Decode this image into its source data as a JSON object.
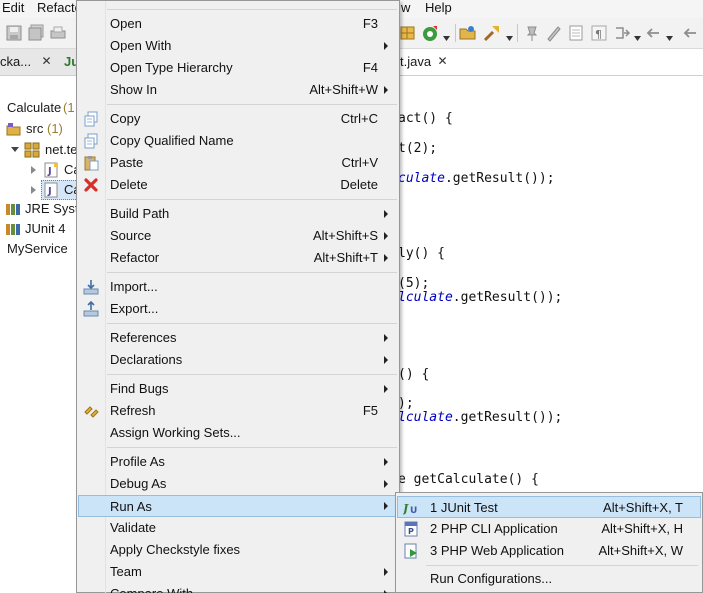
{
  "menubar": {
    "items": [
      "Edit",
      "Refacto",
      "w",
      "Help"
    ]
  },
  "left_tabs": {
    "package_tab": "cka...",
    "junit_tab": "Ju"
  },
  "editor_tabs": {
    "file_tab": "t.java"
  },
  "tree": {
    "project": "Calculate",
    "project_count": "(1",
    "src": "src",
    "src_count": "(1)",
    "package": "net.te",
    "file1": "Ca",
    "file2": "Ca",
    "jre": "JRE Syste",
    "junit": "JUnit 4",
    "service": "MyService"
  },
  "code": {
    "lines": [
      {
        "sig": "act() {",
        "field": ""
      },
      {
        "sig": "t(2);",
        "field": ""
      },
      {
        "sig": ".getResult());",
        "field": "culate"
      },
      {
        "sig": "ly() {",
        "field": ""
      },
      {
        "sig": "(5);",
        "field": ""
      },
      {
        "sig": ".getResult());",
        "field": "lculate"
      },
      {
        "sig": "() {",
        "field": ""
      },
      {
        "sig": ");",
        "field": ""
      },
      {
        "sig": ".getResult());",
        "field": "lculate"
      },
      {
        "sig": "e getCalculate() {",
        "field": ""
      }
    ]
  },
  "context_menu": {
    "items": [
      {
        "label": "Open",
        "accel": "F3",
        "submenu": false,
        "icon": ""
      },
      {
        "label": "Open With",
        "accel": "",
        "submenu": true,
        "icon": ""
      },
      {
        "label": "Open Type Hierarchy",
        "accel": "F4",
        "submenu": false,
        "icon": ""
      },
      {
        "label": "Show In",
        "accel": "Alt+Shift+W",
        "submenu": true,
        "icon": ""
      },
      {
        "label": "Copy",
        "accel": "Ctrl+C",
        "submenu": false,
        "icon": "copy-icon"
      },
      {
        "label": "Copy Qualified Name",
        "accel": "",
        "submenu": false,
        "icon": "copy-qualified-icon"
      },
      {
        "label": "Paste",
        "accel": "Ctrl+V",
        "submenu": false,
        "icon": "paste-icon"
      },
      {
        "label": "Delete",
        "accel": "Delete",
        "submenu": false,
        "icon": "delete-icon"
      },
      {
        "label": "Build Path",
        "accel": "",
        "submenu": true,
        "icon": ""
      },
      {
        "label": "Source",
        "accel": "Alt+Shift+S",
        "submenu": true,
        "icon": ""
      },
      {
        "label": "Refactor",
        "accel": "Alt+Shift+T",
        "submenu": true,
        "icon": ""
      },
      {
        "label": "Import...",
        "accel": "",
        "submenu": false,
        "icon": "import-icon"
      },
      {
        "label": "Export...",
        "accel": "",
        "submenu": false,
        "icon": "export-icon"
      },
      {
        "label": "References",
        "accel": "",
        "submenu": true,
        "icon": ""
      },
      {
        "label": "Declarations",
        "accel": "",
        "submenu": true,
        "icon": ""
      },
      {
        "label": "Find Bugs",
        "accel": "",
        "submenu": true,
        "icon": ""
      },
      {
        "label": "Refresh",
        "accel": "F5",
        "submenu": false,
        "icon": "refresh-icon"
      },
      {
        "label": "Assign Working Sets...",
        "accel": "",
        "submenu": false,
        "icon": ""
      },
      {
        "label": "Profile As",
        "accel": "",
        "submenu": true,
        "icon": ""
      },
      {
        "label": "Debug As",
        "accel": "",
        "submenu": true,
        "icon": ""
      },
      {
        "label": "Run As",
        "accel": "",
        "submenu": true,
        "icon": ""
      },
      {
        "label": "Validate",
        "accel": "",
        "submenu": false,
        "icon": ""
      },
      {
        "label": "Apply Checkstyle fixes",
        "accel": "",
        "submenu": false,
        "icon": ""
      },
      {
        "label": "Team",
        "accel": "",
        "submenu": true,
        "icon": ""
      },
      {
        "label": "Compare With",
        "accel": "",
        "submenu": true,
        "icon": ""
      }
    ]
  },
  "run_as_submenu": {
    "items": [
      {
        "label": "1 JUnit Test",
        "accel": "Alt+Shift+X, T",
        "icon": "junit-icon"
      },
      {
        "label": "2 PHP CLI Application",
        "accel": "Alt+Shift+X, H",
        "icon": "php-cli-icon"
      },
      {
        "label": "3 PHP Web Application",
        "accel": "Alt+Shift+X, W",
        "icon": "php-web-icon"
      },
      {
        "label": "Run Configurations...",
        "accel": "",
        "icon": ""
      }
    ]
  },
  "colors": {
    "menu_bg": "#f0f0f0",
    "hover_bg": "#cce4f7",
    "hover_border": "#95bde0",
    "field_blue": "#0000c0",
    "count_color": "#9a7d2e"
  }
}
